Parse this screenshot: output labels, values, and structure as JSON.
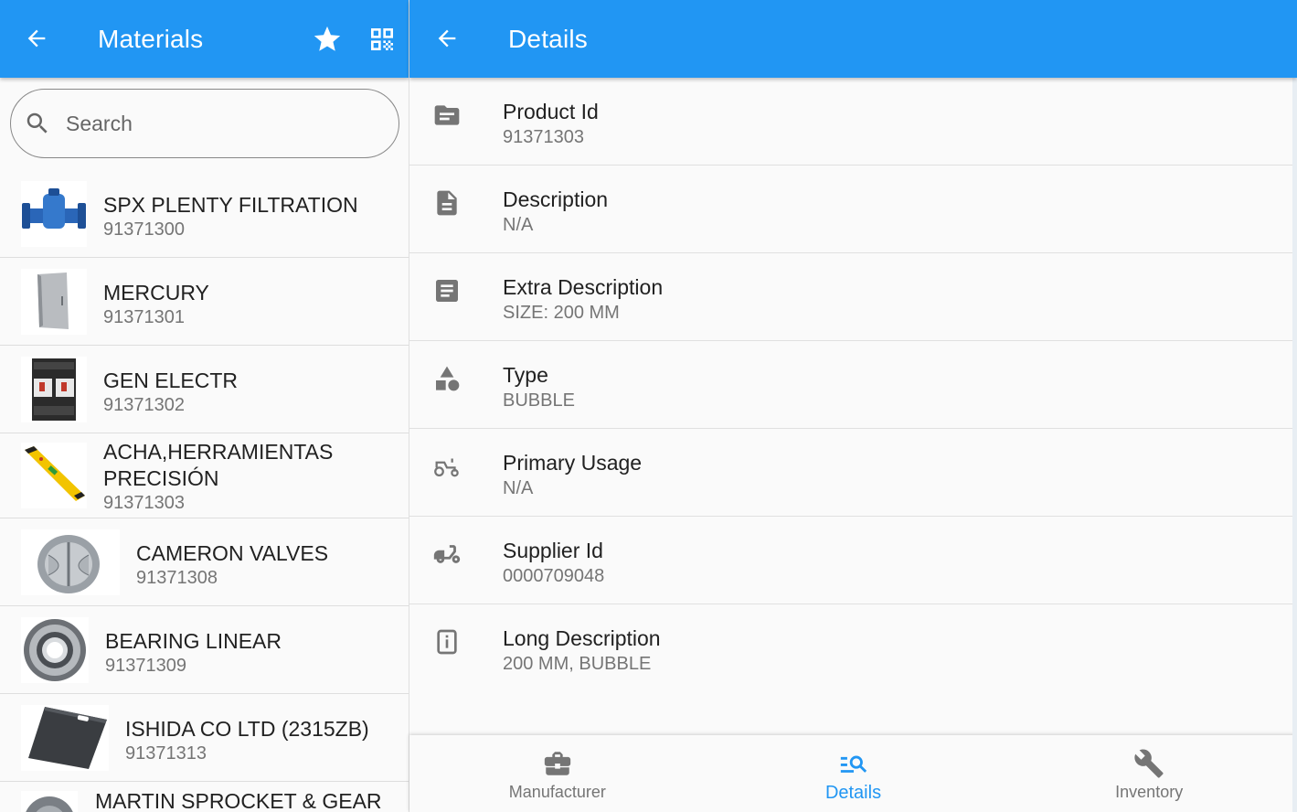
{
  "left": {
    "title": "Materials",
    "back_icon": "arrow-back-icon",
    "actions": [
      "star-icon",
      "qr-code-icon"
    ],
    "search": {
      "placeholder": "Search",
      "value": ""
    },
    "items": [
      {
        "name": "SPX PLENTY FILTRATION",
        "id": "91371300",
        "thumb": "blue-valve"
      },
      {
        "name": "MERCURY",
        "id": "91371301",
        "thumb": "steel-cabinet"
      },
      {
        "name": "GEN ELECTR",
        "id": "91371302",
        "thumb": "circuit-breaker"
      },
      {
        "name": "ACHA,HERRAMIENTAS PRECISIÓN",
        "id": "91371303",
        "thumb": "spirit-level"
      },
      {
        "name": "CAMERON VALVES",
        "id": "91371308",
        "thumb": "check-valve"
      },
      {
        "name": "BEARING LINEAR",
        "id": "91371309",
        "thumb": "ball-bearing"
      },
      {
        "name": "ISHIDA CO LTD (2315ZB)",
        "id": "91371313",
        "thumb": "metal-plate"
      },
      {
        "name": "MARTIN SPROCKET & GEAR",
        "id": "",
        "thumb": "sprocket"
      }
    ]
  },
  "right": {
    "title": "Details",
    "back_icon": "arrow-back-icon",
    "details": [
      {
        "label": "Product Id",
        "value": "91371303",
        "icon": "folder-icon"
      },
      {
        "label": "Description",
        "value": "N/A",
        "icon": "description-icon"
      },
      {
        "label": "Extra Description",
        "value": "SIZE: 200 MM",
        "icon": "article-icon"
      },
      {
        "label": "Type",
        "value": "BUBBLE",
        "icon": "category-icon"
      },
      {
        "label": "Primary Usage",
        "value": "N/A",
        "icon": "tractor-icon"
      },
      {
        "label": "Supplier Id",
        "value": "0000709048",
        "icon": "moped-icon"
      },
      {
        "label": "Long Description",
        "value": "200 MM, BUBBLE",
        "icon": "info-box-icon"
      }
    ],
    "bottom_nav": [
      {
        "label": "Manufacturer",
        "icon": "briefcase-icon",
        "active": false
      },
      {
        "label": "Details",
        "icon": "manage-search-icon",
        "active": true
      },
      {
        "label": "Inventory",
        "icon": "wrench-icon",
        "active": false
      }
    ]
  },
  "colors": {
    "primary": "#2196f3",
    "text_primary": "#212121",
    "text_secondary": "#757575"
  }
}
